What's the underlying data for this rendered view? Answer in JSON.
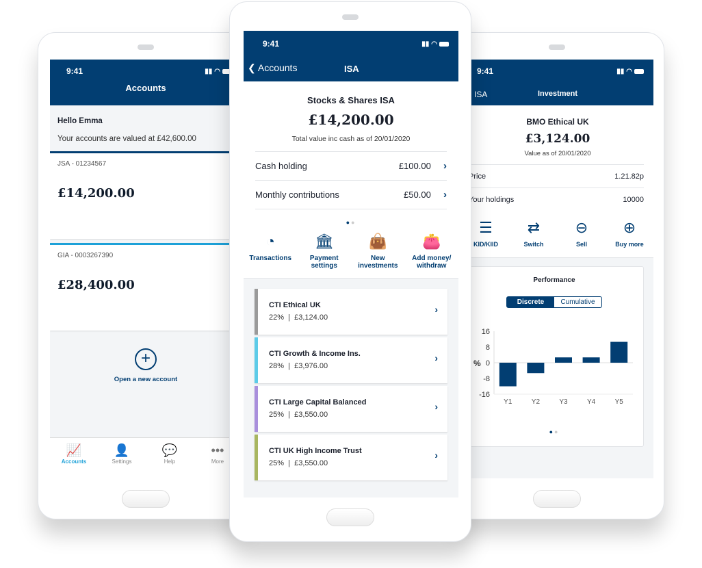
{
  "status_time": "9:41",
  "accounts_screen": {
    "title": "Accounts",
    "greeting": "Hello Emma",
    "summary": "Your accounts are valued at £42,600.00",
    "accounts": [
      {
        "label": "JSA - 01234567",
        "value": "£14,200.00",
        "accent": "#023e72"
      },
      {
        "label": "GIA - 0003267390",
        "value": "£28,400.00",
        "accent": "#1da1d8"
      }
    ],
    "open_account": "Open a new account",
    "tabs": [
      {
        "label": "Accounts",
        "icon": "chart-growth-icon",
        "active": true
      },
      {
        "label": "Settings",
        "icon": "person-icon",
        "active": false
      },
      {
        "label": "Help",
        "icon": "chat-bubbles-icon",
        "active": false
      },
      {
        "label": "More",
        "icon": "ellipsis-icon",
        "active": false
      }
    ]
  },
  "isa_screen": {
    "back_label": "Accounts",
    "title": "ISA",
    "account_name": "Stocks & Shares ISA",
    "total": "£14,200.00",
    "total_note": "Total value inc cash as of 20/01/2020",
    "rows": [
      {
        "label": "Cash holding",
        "value": "£100.00"
      },
      {
        "label": "Monthly contributions",
        "value": "£50.00"
      }
    ],
    "actions": [
      {
        "label": "Transactions",
        "icon": "clock-icon"
      },
      {
        "label": "Payment settings",
        "icon": "bank-settings-icon"
      },
      {
        "label": "New investments",
        "icon": "shopping-bag-icon"
      },
      {
        "label": "Add money/ withdraw",
        "icon": "wallet-icon"
      }
    ],
    "funds": [
      {
        "name": "CTI Ethical UK",
        "pct": "22%",
        "value": "£3,124.00",
        "color": "#9a9a9a"
      },
      {
        "name": "CTI Growth & Income Ins.",
        "pct": "28%",
        "value": "£3,976.00",
        "color": "#5ccbe8"
      },
      {
        "name": "CTI Large Capital Balanced",
        "pct": "25%",
        "value": "£3,550.00",
        "color": "#a98fdc"
      },
      {
        "name": "CTI UK High Income Trust",
        "pct": "25%",
        "value": "£3,550.00",
        "color": "#a8b660"
      }
    ]
  },
  "investment_screen": {
    "back_label": "ISA",
    "title": "Investment",
    "fund_name": "BMO Ethical UK",
    "value": "£3,124.00",
    "value_note": "Value as of 20/01/2020",
    "rows": [
      {
        "label": "Price",
        "value": "1.21.82p"
      },
      {
        "label": "Your holdings",
        "value": "10000"
      }
    ],
    "actions": [
      {
        "label": "KID/KIID",
        "icon": "document-list-icon"
      },
      {
        "label": "Switch",
        "icon": "switch-arrows-icon"
      },
      {
        "label": "Sell",
        "icon": "minus-circle-icon"
      },
      {
        "label": "Buy more",
        "icon": "plus-circle-icon"
      }
    ],
    "performance_title": "Performance",
    "segments": [
      "Discrete",
      "Cumulative"
    ],
    "selected_segment": "Discrete"
  },
  "chart_data": {
    "type": "bar",
    "title": "Performance",
    "categories": [
      "Y1",
      "Y2",
      "Y3",
      "Y4",
      "Y5"
    ],
    "values": [
      -12,
      -5.3,
      2.7,
      2.7,
      10.6
    ],
    "ylabel": "%",
    "yticks": [
      16,
      8,
      0,
      -8,
      -16
    ],
    "ylim": [
      -16,
      16
    ],
    "bar_color": "#023e72"
  }
}
